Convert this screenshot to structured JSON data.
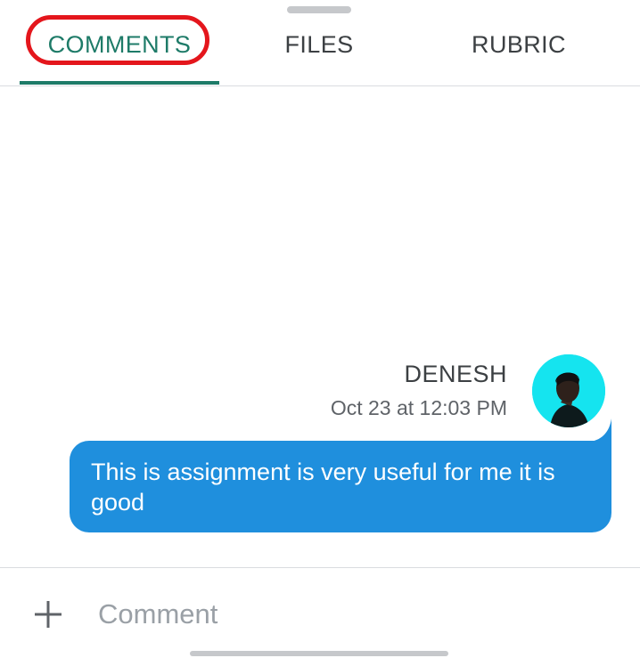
{
  "tabs": [
    {
      "label": "COMMENTS",
      "active": true
    },
    {
      "label": "FILES",
      "active": false
    },
    {
      "label": "RUBRIC",
      "active": false
    }
  ],
  "accent_color": "#1e7b68",
  "highlight_color": "#e4161c",
  "comment": {
    "author": "DENESH",
    "timestamp": "Oct 23 at 12:03 PM",
    "text": "This is assignment is very useful for me it is good",
    "bubble_color": "#1f8fdd"
  },
  "composer": {
    "add_icon": "plus-icon",
    "placeholder": "Comment"
  }
}
